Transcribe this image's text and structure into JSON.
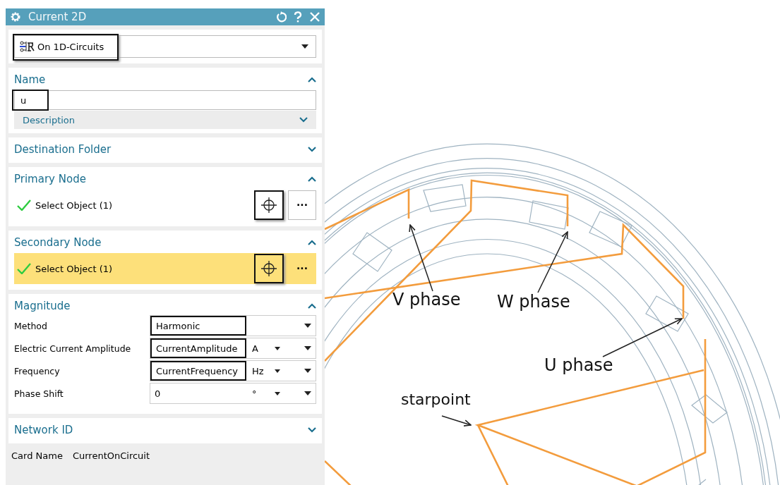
{
  "window": {
    "title": "Current 2D"
  },
  "type_dropdown": {
    "value": "On 1D-Circuits",
    "highlighted": true
  },
  "sections": [
    {
      "kind": "name",
      "title": "Name",
      "expanded": true,
      "name_field": {
        "value": "u",
        "highlighted": true
      },
      "description": {
        "label": "Description",
        "expanded": false
      }
    },
    {
      "kind": "plain",
      "title": "Destination Folder",
      "expanded": false
    },
    {
      "kind": "node",
      "title": "Primary Node",
      "expanded": true,
      "select_label": "Select Object (1)",
      "complete": true,
      "selected": false,
      "pick_highlighted": true,
      "more": "···"
    },
    {
      "kind": "node",
      "title": "Secondary Node",
      "expanded": true,
      "select_label": "Select Object (1)",
      "complete": true,
      "selected": true,
      "pick_highlighted": true,
      "more": "···"
    },
    {
      "kind": "magnitude",
      "title": "Magnitude",
      "expanded": true,
      "rows": [
        {
          "kind": "dropdown",
          "label": "Method",
          "value": "Harmonic",
          "highlighted": true
        },
        {
          "kind": "expression",
          "label": "Electric Current Amplitude",
          "value": "CurrentAmplitude",
          "unit": "A",
          "highlighted": true
        },
        {
          "kind": "expression",
          "label": "Frequency",
          "value": "CurrentFrequency",
          "unit": "Hz",
          "highlighted": true
        },
        {
          "kind": "expression",
          "label": "Phase Shift",
          "value": "0",
          "unit": "°",
          "highlighted": false
        }
      ]
    },
    {
      "kind": "plain",
      "title": "Network ID",
      "expanded": false
    }
  ],
  "card_name": {
    "label": "Card Name",
    "value": "CurrentOnCircuit"
  },
  "diagram": {
    "labels": [
      "V phase",
      "W phase",
      "U phase",
      "starpoint"
    ]
  }
}
